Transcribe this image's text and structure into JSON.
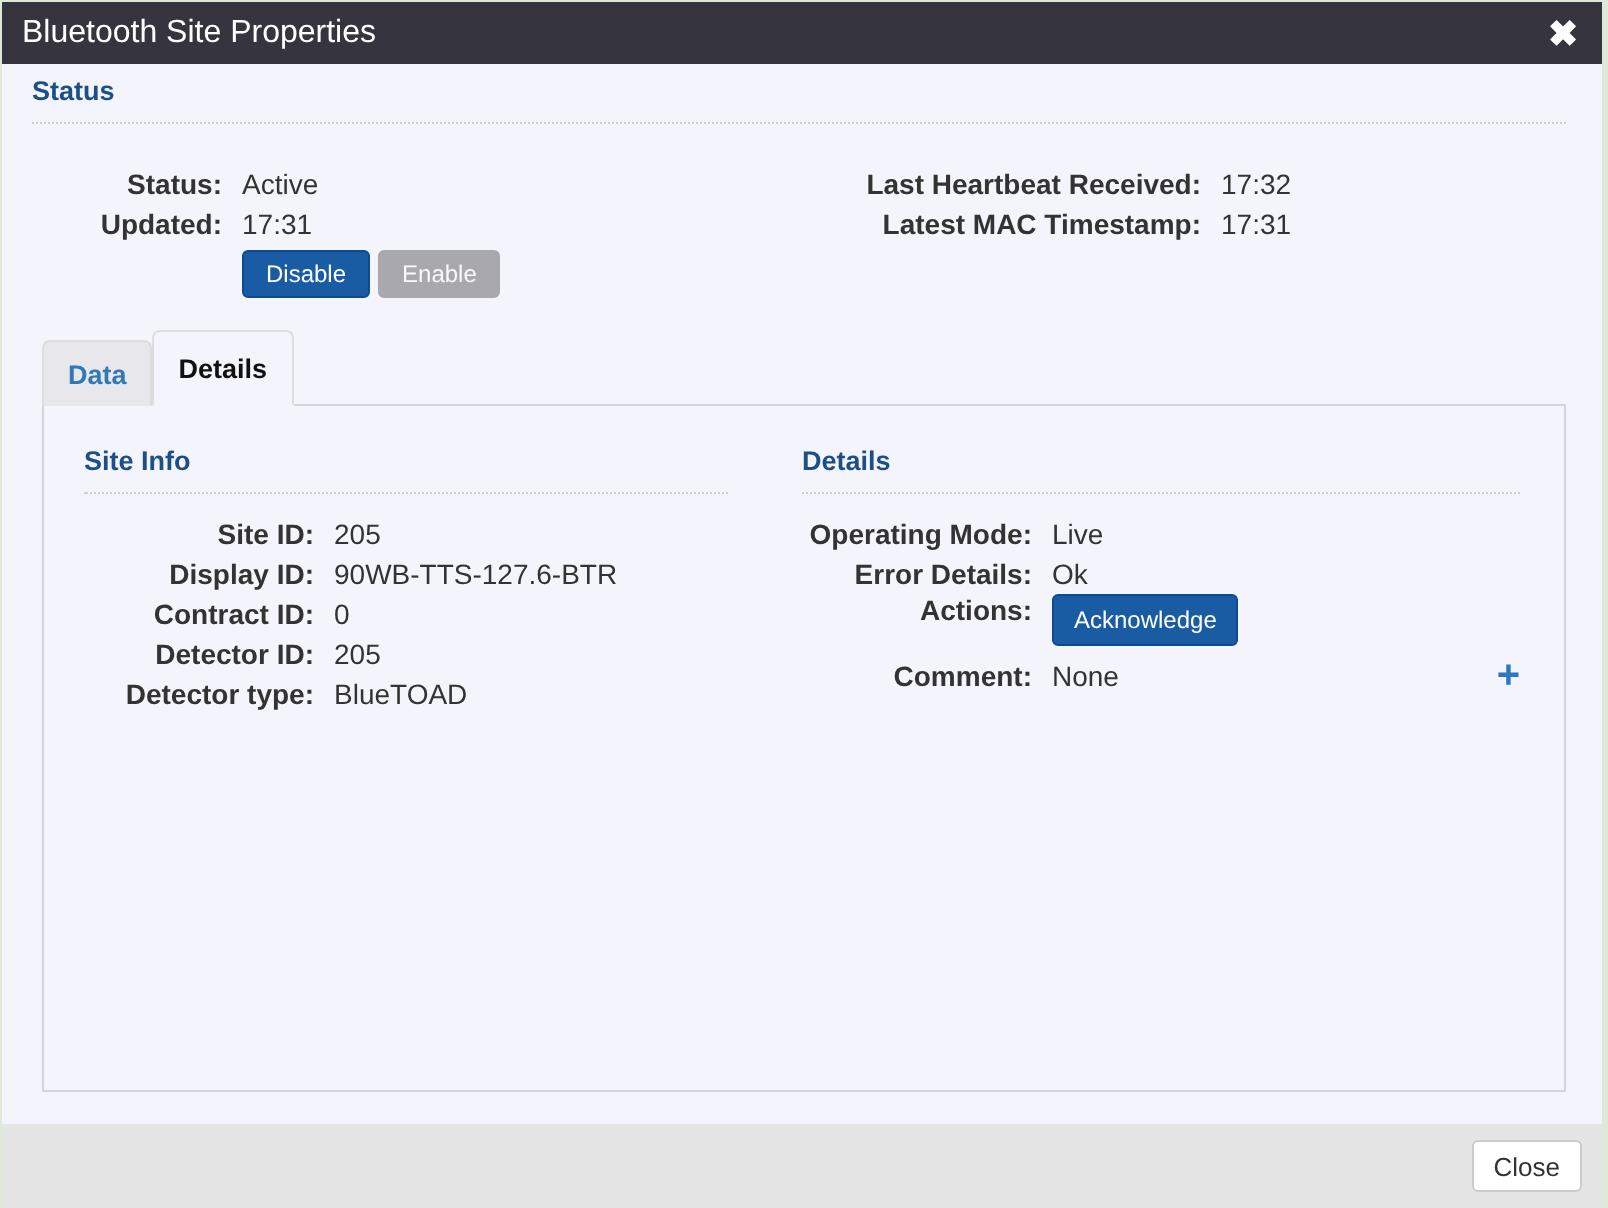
{
  "window": {
    "title": "Bluetooth Site Properties",
    "close_icon": "✖"
  },
  "status": {
    "heading": "Status",
    "left": [
      {
        "label": "Status:",
        "value": "Active"
      },
      {
        "label": "Updated:",
        "value": "17:31"
      }
    ],
    "right": [
      {
        "label": "Last Heartbeat Received:",
        "value": "17:32"
      },
      {
        "label": "Latest MAC Timestamp:",
        "value": "17:31"
      }
    ],
    "buttons": [
      {
        "label": "Disable",
        "disabled": false
      },
      {
        "label": "Enable",
        "disabled": true
      }
    ]
  },
  "tabs": [
    {
      "label": "Data",
      "selected": false
    },
    {
      "label": "Details",
      "selected": true
    }
  ],
  "site_info": {
    "heading": "Site Info",
    "rows": [
      {
        "label": "Site ID:",
        "value": "205"
      },
      {
        "label": "Display ID:",
        "value": "90WB-TTS-127.6-BTR"
      },
      {
        "label": "Contract ID:",
        "value": "0"
      },
      {
        "label": "Detector ID:",
        "value": "205"
      },
      {
        "label": "Detector type:",
        "value": "BlueTOAD"
      }
    ]
  },
  "details": {
    "heading": "Details",
    "rows": [
      {
        "kind": "text",
        "label": "Operating Mode:",
        "value": "Live"
      },
      {
        "kind": "text",
        "label": "Error Details:",
        "value": "Ok"
      },
      {
        "kind": "button",
        "label": "Actions:",
        "value": "Acknowledge"
      },
      {
        "kind": "add",
        "label": "Comment:",
        "value": "None",
        "add": "+"
      }
    ]
  },
  "footer": {
    "close": "Close"
  }
}
